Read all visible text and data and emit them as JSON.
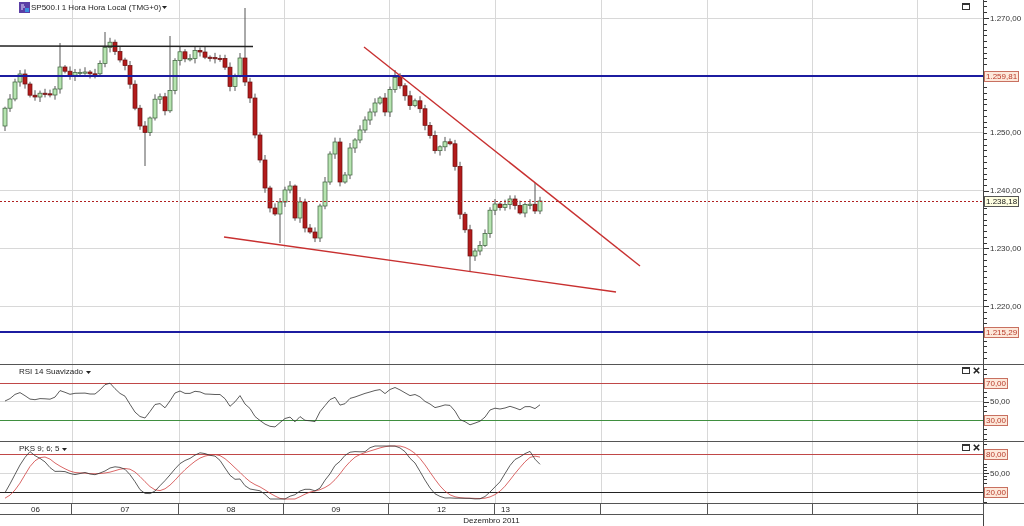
{
  "main_panel": {
    "title": "SP500.I 1 Hora Hora Local (TMG+0)",
    "price_axis": [
      {
        "label": "1.270,00",
        "kind": "tick"
      },
      {
        "label": "1.259,81",
        "kind": "level"
      },
      {
        "label": "1.250,00",
        "kind": "tick"
      },
      {
        "label": "1.240,00",
        "kind": "tick"
      },
      {
        "label": "1.238,18",
        "kind": "last"
      },
      {
        "label": "1.230,00",
        "kind": "tick"
      },
      {
        "label": "1.220,00",
        "kind": "tick"
      },
      {
        "label": "1.215,29",
        "kind": "level"
      }
    ]
  },
  "indicator_panels": [
    {
      "kind": "rsi",
      "title": "RSI 14 Suavizado",
      "axis": [
        {
          "label": "70,00",
          "kind": "level"
        },
        {
          "label": "50,00",
          "kind": "tick"
        },
        {
          "label": "30,00",
          "kind": "level"
        }
      ]
    },
    {
      "kind": "stochastic",
      "title": "PKS 9; 6; 5",
      "axis": [
        {
          "label": "80,00",
          "kind": "level"
        },
        {
          "label": "50,00",
          "kind": "tick"
        },
        {
          "label": "20,00",
          "kind": "level"
        }
      ]
    }
  ],
  "time_axis": {
    "days": [
      "06",
      "07",
      "08",
      "09",
      "12",
      "13"
    ],
    "month": "Dezembro 2011"
  }
}
